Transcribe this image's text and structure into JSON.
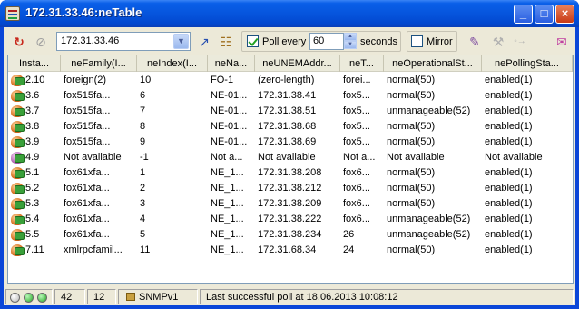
{
  "window": {
    "title": "172.31.33.46:neTable"
  },
  "toolbar": {
    "address": "172.31.33.46",
    "poll_label": "Poll every",
    "poll_interval": "60",
    "seconds_label": "seconds",
    "mirror_label": "Mirror",
    "poll_checked": true,
    "mirror_checked": false
  },
  "table": {
    "columns": [
      "Insta...",
      "neFamily(I...",
      "neIndex(I...",
      "neNa...",
      "neUNEMAddr...",
      "neT...",
      "neOperationalSt...",
      "nePollingSta..."
    ],
    "rows": [
      [
        "2.10",
        "foreign(2)",
        "10",
        "FO-1",
        "(zero-length)",
        "forei...",
        "normal(50)",
        "enabled(1)"
      ],
      [
        "3.6",
        "fox515fa...",
        "6",
        "NE-01...",
        "172.31.38.41",
        "fox5...",
        "normal(50)",
        "enabled(1)"
      ],
      [
        "3.7",
        "fox515fa...",
        "7",
        "NE-01...",
        "172.31.38.51",
        "fox5...",
        "unmanageable(52)",
        "enabled(1)"
      ],
      [
        "3.8",
        "fox515fa...",
        "8",
        "NE-01...",
        "172.31.38.68",
        "fox5...",
        "normal(50)",
        "enabled(1)"
      ],
      [
        "3.9",
        "fox515fa...",
        "9",
        "NE-01...",
        "172.31.38.69",
        "fox5...",
        "normal(50)",
        "enabled(1)"
      ],
      [
        "4.9",
        "Not available",
        "-1",
        "Not a...",
        "Not available",
        "Not a...",
        "Not available",
        "Not available"
      ],
      [
        "5.1",
        "fox61xfa...",
        "1",
        "NE_1...",
        "172.31.38.208",
        "fox6...",
        "normal(50)",
        "enabled(1)"
      ],
      [
        "5.2",
        "fox61xfa...",
        "2",
        "NE_1...",
        "172.31.38.212",
        "fox6...",
        "normal(50)",
        "enabled(1)"
      ],
      [
        "5.3",
        "fox61xfa...",
        "3",
        "NE_1...",
        "172.31.38.209",
        "fox6...",
        "normal(50)",
        "enabled(1)"
      ],
      [
        "5.4",
        "fox61xfa...",
        "4",
        "NE_1...",
        "172.31.38.222",
        "fox6...",
        "unmanageable(52)",
        "enabled(1)"
      ],
      [
        "5.5",
        "fox61xfa...",
        "5",
        "NE_1...",
        "172.31.38.234",
        "26",
        "unmanageable(52)",
        "enabled(1)"
      ],
      [
        "7.11",
        "xmlrpcfamil...",
        "11",
        "NE_1...",
        "172.31.68.34",
        "24",
        "normal(50)",
        "enabled(1)"
      ]
    ],
    "row_icon_variant": [
      "normal",
      "normal",
      "normal",
      "normal",
      "normal",
      "alt",
      "normal",
      "normal",
      "normal",
      "normal",
      "normal",
      "normal"
    ]
  },
  "statusbar": {
    "count_total": "42",
    "count_rows": "12",
    "protocol": "SNMPv1",
    "message": "Last successful poll at 18.06.2013 10:08:12"
  }
}
